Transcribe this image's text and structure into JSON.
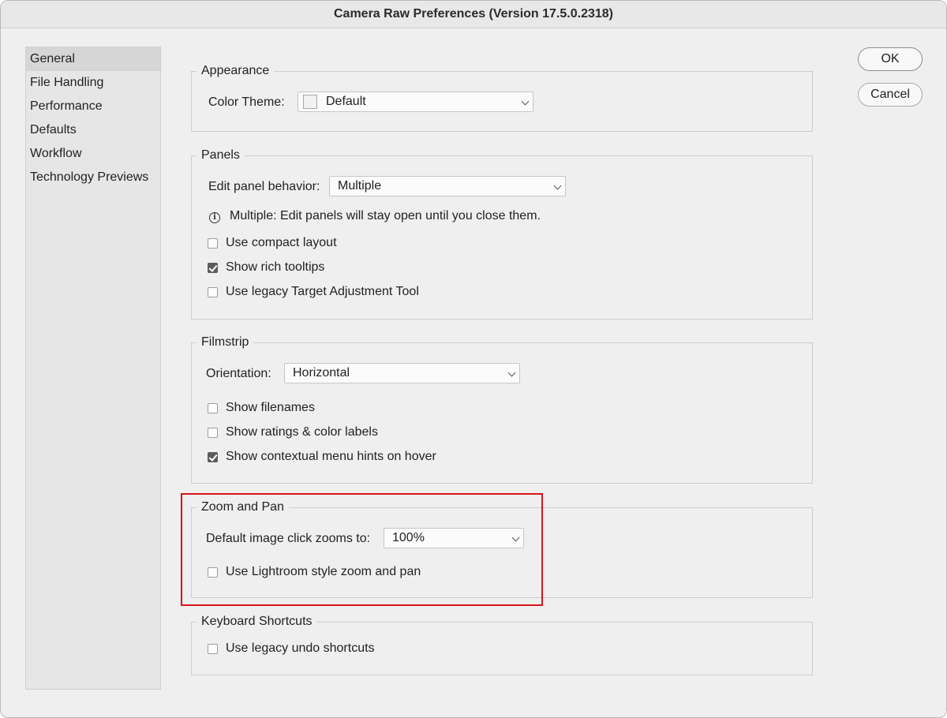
{
  "window": {
    "title": "Camera Raw Preferences  (Version 17.5.0.2318)"
  },
  "sidebar": {
    "items": [
      {
        "label": "General",
        "selected": true
      },
      {
        "label": "File Handling"
      },
      {
        "label": "Performance"
      },
      {
        "label": "Defaults"
      },
      {
        "label": "Workflow"
      },
      {
        "label": "Technology Previews"
      }
    ]
  },
  "buttons": {
    "ok": "OK",
    "cancel": "Cancel"
  },
  "appearance": {
    "title": "Appearance",
    "color_theme_label": "Color Theme:",
    "color_theme_value": "Default"
  },
  "panels": {
    "title": "Panels",
    "edit_behavior_label": "Edit panel behavior:",
    "edit_behavior_value": "Multiple",
    "info_text": "Multiple: Edit panels will stay open until you close them.",
    "checkboxes": [
      {
        "label": "Use compact layout",
        "checked": false
      },
      {
        "label": "Show rich tooltips",
        "checked": true
      },
      {
        "label": "Use legacy Target Adjustment Tool",
        "checked": false
      }
    ]
  },
  "filmstrip": {
    "title": "Filmstrip",
    "orientation_label": "Orientation:",
    "orientation_value": "Horizontal",
    "checkboxes": [
      {
        "label": "Show filenames",
        "checked": false
      },
      {
        "label": "Show ratings & color labels",
        "checked": false
      },
      {
        "label": "Show contextual menu hints on hover",
        "checked": true
      }
    ]
  },
  "zoom_pan": {
    "title": "Zoom and Pan",
    "default_zoom_label": "Default image click zooms to:",
    "default_zoom_value": "100%",
    "checkboxes": [
      {
        "label": "Use Lightroom style zoom and pan",
        "checked": false
      }
    ]
  },
  "keyboard": {
    "title": "Keyboard Shortcuts",
    "checkboxes": [
      {
        "label": "Use legacy undo shortcuts",
        "checked": false
      }
    ]
  },
  "colors": {
    "highlight": "#d7141b",
    "checkbox_checked": "#5c5c5c"
  }
}
